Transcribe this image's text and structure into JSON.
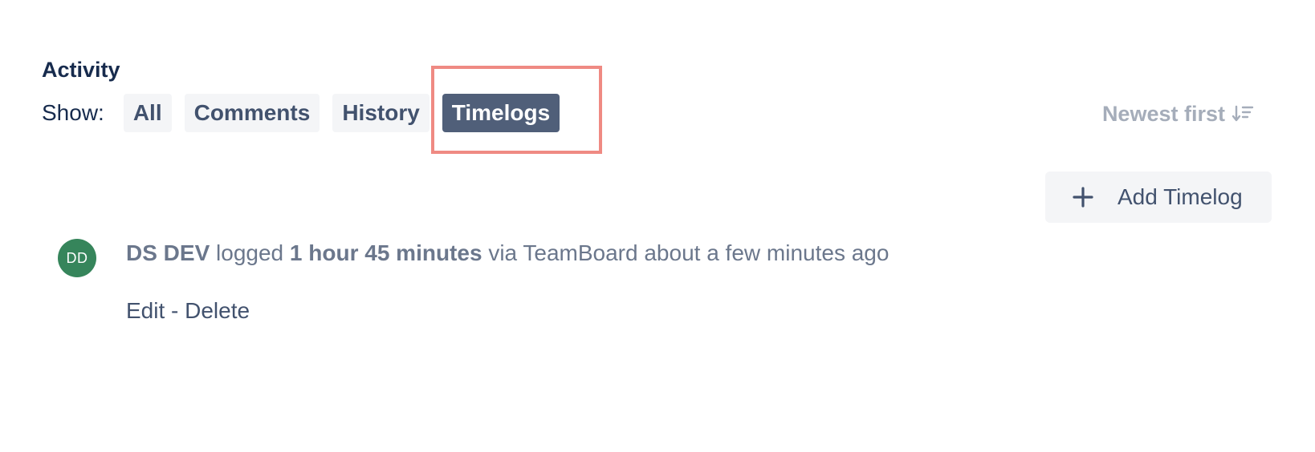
{
  "activity": {
    "title": "Activity",
    "show_label": "Show:",
    "filters": [
      {
        "label": "All",
        "active": false
      },
      {
        "label": "Comments",
        "active": false
      },
      {
        "label": "History",
        "active": false
      },
      {
        "label": "Timelogs",
        "active": true
      }
    ],
    "sort_label": "Newest first",
    "sort_icon": "sort-descending-icon"
  },
  "add_timelog": {
    "label": "Add Timelog",
    "icon": "plus-icon"
  },
  "timelog_entry": {
    "avatar_initials": "DD",
    "avatar_color": "#36855b",
    "user": "DS DEV",
    "verb": "logged",
    "duration": "1 hour 45 minutes",
    "via": "via TeamBoard",
    "time": "about a few minutes ago",
    "edit_label": "Edit",
    "separator": "-",
    "delete_label": "Delete"
  },
  "colors": {
    "active_filter_bg": "#505f79",
    "highlight_border": "#ef8a83"
  }
}
